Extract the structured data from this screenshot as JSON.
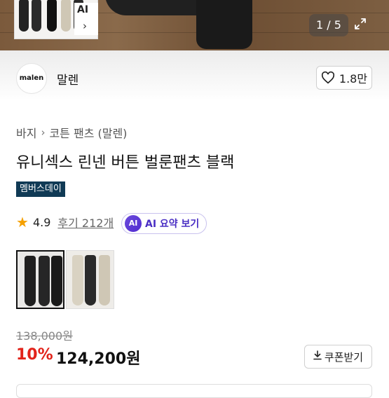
{
  "gallery": {
    "ai_label": "AI",
    "counter": "1 / 5"
  },
  "brand": {
    "logo_text": "malen",
    "name": "말렌",
    "likes": "1.8만"
  },
  "breadcrumb": {
    "level1": "바지",
    "level2": "코튼 팬츠 (말렌)"
  },
  "product": {
    "title": "유니섹스 린넨 버튼 벌룬팬츠 블랙",
    "badge": "멤버스데이",
    "rating": "4.9",
    "reviews": "후기 212개",
    "ai_summary_chip": "AI",
    "ai_summary_label": "AI 요약 보기",
    "color_options": [
      {
        "name": "black",
        "color": "#1f1f1f"
      },
      {
        "name": "beige",
        "color": "#d9d2c2"
      }
    ]
  },
  "price": {
    "original": "138,000원",
    "discount": "10%",
    "final": "124,200원",
    "coupon_label": "쿠폰받기"
  },
  "colors": {
    "discount": "#e2231a",
    "badge_bg": "#103a55",
    "ai_accent": "#4a2fc4",
    "star": "#f5a000"
  }
}
